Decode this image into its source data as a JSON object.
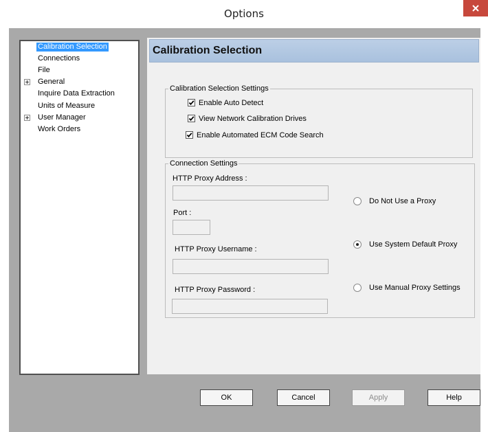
{
  "window": {
    "title": "Options"
  },
  "nav": {
    "items": [
      {
        "label": "Calibration Selection",
        "selected": true,
        "expandable": false
      },
      {
        "label": "Connections",
        "selected": false,
        "expandable": false
      },
      {
        "label": "File",
        "selected": false,
        "expandable": false
      },
      {
        "label": "General",
        "selected": false,
        "expandable": true
      },
      {
        "label": "Inquire Data Extraction",
        "selected": false,
        "expandable": false
      },
      {
        "label": "Units of Measure",
        "selected": false,
        "expandable": false
      },
      {
        "label": "User Manager",
        "selected": false,
        "expandable": true
      },
      {
        "label": "Work Orders",
        "selected": false,
        "expandable": false
      }
    ]
  },
  "panel": {
    "title": "Calibration Selection"
  },
  "calibration_settings": {
    "title": "Calibration Selection Settings",
    "enable_auto_detect": {
      "label": "Enable Auto Detect",
      "checked": true
    },
    "view_network_drives": {
      "label": "View Network Calibration Drives",
      "checked": true
    },
    "automated_ecm_search": {
      "label": "Enable Automated ECM Code Search",
      "checked": true
    }
  },
  "connection_settings": {
    "title": "Connection Settings",
    "proxy_address_label": "HTTP Proxy Address :",
    "proxy_address_value": "",
    "port_label": "Port :",
    "port_value": "",
    "proxy_username_label": "HTTP Proxy Username :",
    "proxy_username_value": "",
    "proxy_password_label": "HTTP Proxy Password :",
    "proxy_password_value": "",
    "radio_no_proxy": {
      "label": "Do Not Use a Proxy",
      "checked": false
    },
    "radio_system_default": {
      "label": "Use System Default Proxy",
      "checked": true
    },
    "radio_manual": {
      "label": "Use Manual Proxy Settings",
      "checked": false
    }
  },
  "buttons": {
    "ok": "OK",
    "cancel": "Cancel",
    "apply": {
      "label": "Apply",
      "enabled": false
    },
    "help": "Help"
  },
  "colors": {
    "selection": "#3399ff",
    "close_button": "#c7483c",
    "header_gradient_top": "#bccfe6",
    "header_gradient_bottom": "#a9c1de",
    "client_background": "#a9a9a9",
    "panel_background": "#f0f0f0"
  }
}
